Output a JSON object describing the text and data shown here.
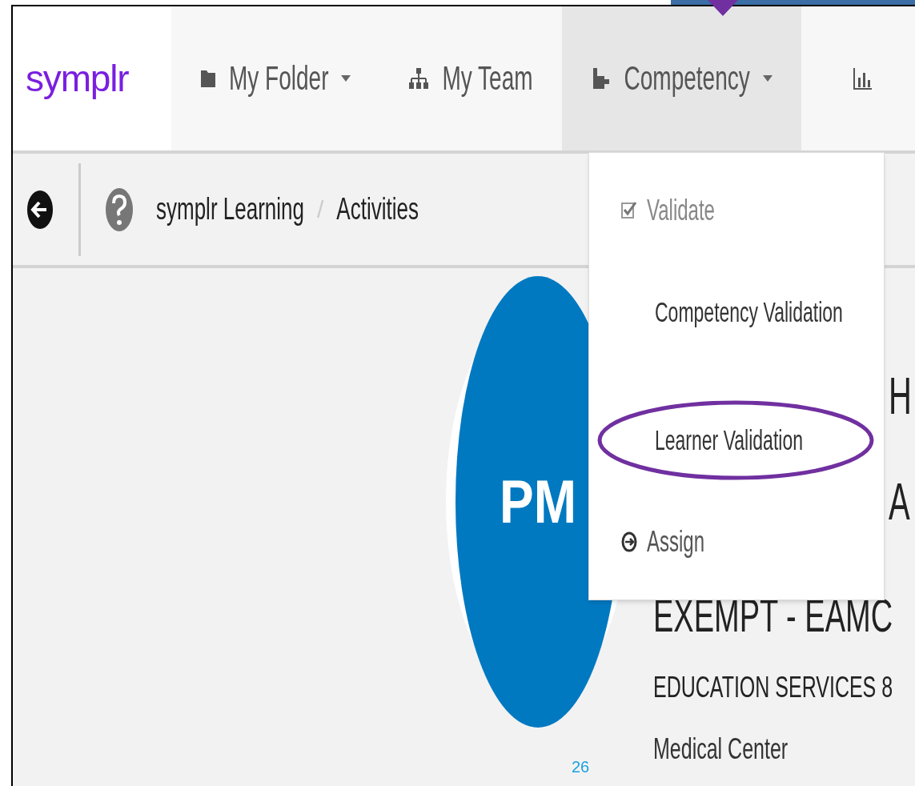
{
  "logo": {
    "text": "symplr"
  },
  "nav": {
    "items": [
      {
        "label": "My Folder",
        "dropdown": true,
        "selected": false
      },
      {
        "label": "My Team",
        "dropdown": false,
        "selected": false
      },
      {
        "label": "Competency",
        "dropdown": true,
        "selected": true
      }
    ]
  },
  "breadcrumb": {
    "items": [
      "symplr Learning",
      "Activities"
    ],
    "separator": "/"
  },
  "dropdown_menu": {
    "items": [
      {
        "kind": "group",
        "label": "Validate"
      },
      {
        "kind": "link",
        "label": "Competency Validation",
        "highlighted": false
      },
      {
        "kind": "link",
        "label": "Learner Validation",
        "highlighted": true
      },
      {
        "kind": "action",
        "label": "Assign"
      }
    ]
  },
  "profile": {
    "initials": "PM",
    "name_fragment": "H",
    "title_fragment": "A",
    "department": "EXEMPT - EAMC",
    "unit": "EDUCATION SERVICES 8",
    "facility": "Medical Center"
  },
  "page_number": "26"
}
